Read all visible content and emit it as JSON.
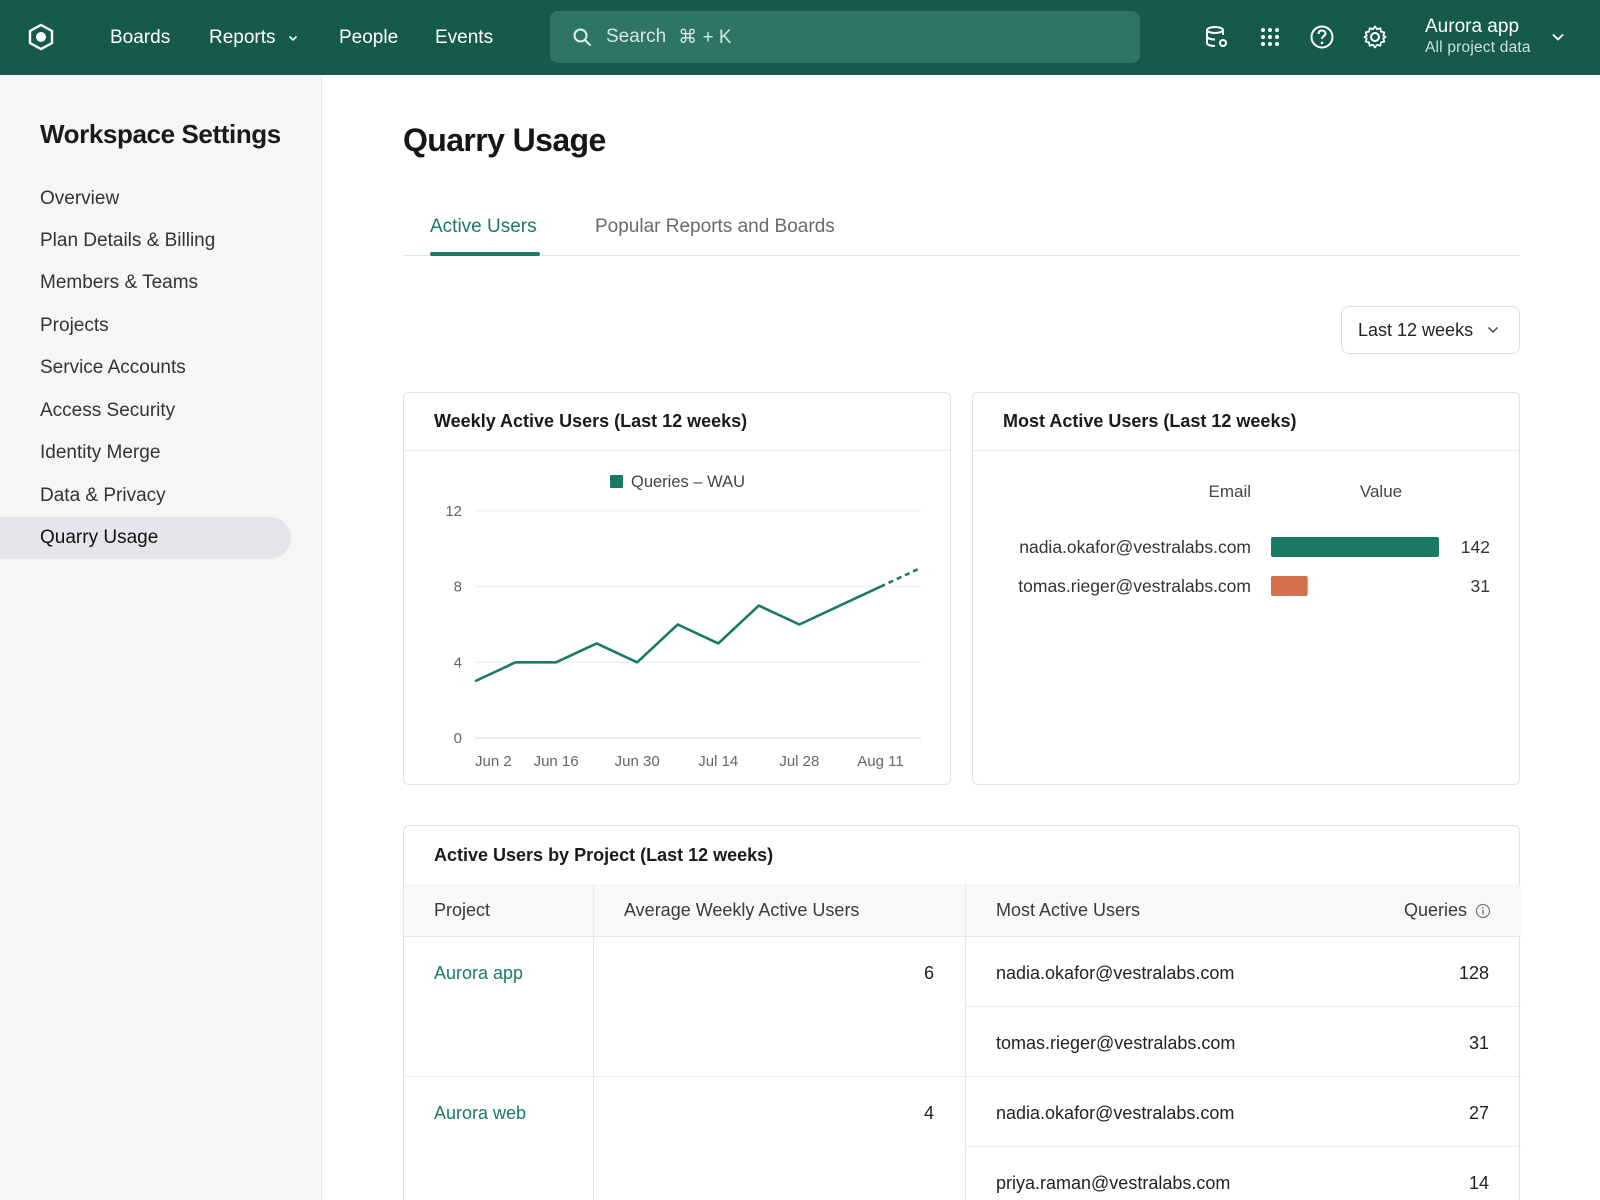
{
  "topbar": {
    "nav": [
      {
        "label": "Boards"
      },
      {
        "label": "Reports"
      },
      {
        "label": "People"
      },
      {
        "label": "Events"
      }
    ],
    "search_placeholder": "Search",
    "search_shortcut": "⌘ + K",
    "project_name": "Aurora app",
    "project_scope": "All project data"
  },
  "sidebar": {
    "title": "Workspace Settings",
    "items": [
      {
        "label": "Overview"
      },
      {
        "label": "Plan Details & Billing"
      },
      {
        "label": "Members & Teams"
      },
      {
        "label": "Projects"
      },
      {
        "label": "Service Accounts"
      },
      {
        "label": "Access Security"
      },
      {
        "label": "Identity Merge"
      },
      {
        "label": "Data & Privacy"
      },
      {
        "label": "Quarry Usage",
        "active": true
      }
    ]
  },
  "main": {
    "title": "Quarry Usage",
    "tabs": [
      {
        "label": "Active Users",
        "active": true
      },
      {
        "label": "Popular Reports and Boards"
      }
    ],
    "range_select": "Last 12 weeks",
    "wau_card_title": "Weekly Active Users (Last 12 weeks)",
    "top_users_card_title": "Most Active Users (Last 12 weeks)",
    "by_project": {
      "title": "Active Users by Project (Last 12 weeks)",
      "columns": [
        "Project",
        "Average Weekly Active Users",
        "Most Active Users",
        "Queries"
      ],
      "rows": [
        {
          "project": "Aurora app",
          "avg_wau": "6",
          "users": [
            {
              "email": "nadia.okafor@vestralabs.com",
              "queries": "128"
            },
            {
              "email": "tomas.rieger@vestralabs.com",
              "queries": "31"
            }
          ]
        },
        {
          "project": "Aurora web",
          "avg_wau": "4",
          "users": [
            {
              "email": "nadia.okafor@vestralabs.com",
              "queries": "27"
            },
            {
              "email": "priya.raman@vestralabs.com",
              "queries": "14"
            }
          ]
        }
      ]
    }
  },
  "colors": {
    "brand": "#155a4b",
    "accent": "#1a7a63",
    "secondary_bar": "#d4704a"
  },
  "chart_data": [
    {
      "type": "line",
      "title": "Weekly Active Users (Last 12 weeks)",
      "series": [
        {
          "name": "Queries – WAU",
          "values": [
            3,
            4,
            4,
            5,
            4,
            6,
            5,
            7,
            6,
            7,
            8,
            9
          ],
          "last_segment_dashed": true
        }
      ],
      "x": [
        "Jun 2",
        "Jun 9",
        "Jun 16",
        "Jun 23",
        "Jun 30",
        "Jul 7",
        "Jul 14",
        "Jul 21",
        "Jul 28",
        "Aug 4",
        "Aug 11",
        "Aug 18"
      ],
      "x_tick_labels": [
        "Jun 2",
        "Jun 16",
        "Jun 30",
        "Jul 14",
        "Jul 28",
        "Aug 11"
      ],
      "y_ticks": [
        0,
        4,
        8,
        12
      ],
      "ylim": [
        0,
        12
      ],
      "grid": true,
      "legend": "top-center"
    },
    {
      "type": "bar",
      "orientation": "horizontal",
      "title": "Most Active Users (Last 12 weeks)",
      "column_headers": [
        "Email",
        "Value"
      ],
      "categories": [
        "nadia.okafor@vestralabs.com",
        "tomas.rieger@vestralabs.com"
      ],
      "values": [
        142,
        31
      ],
      "colors": [
        "#1a7a63",
        "#d4704a"
      ]
    }
  ]
}
